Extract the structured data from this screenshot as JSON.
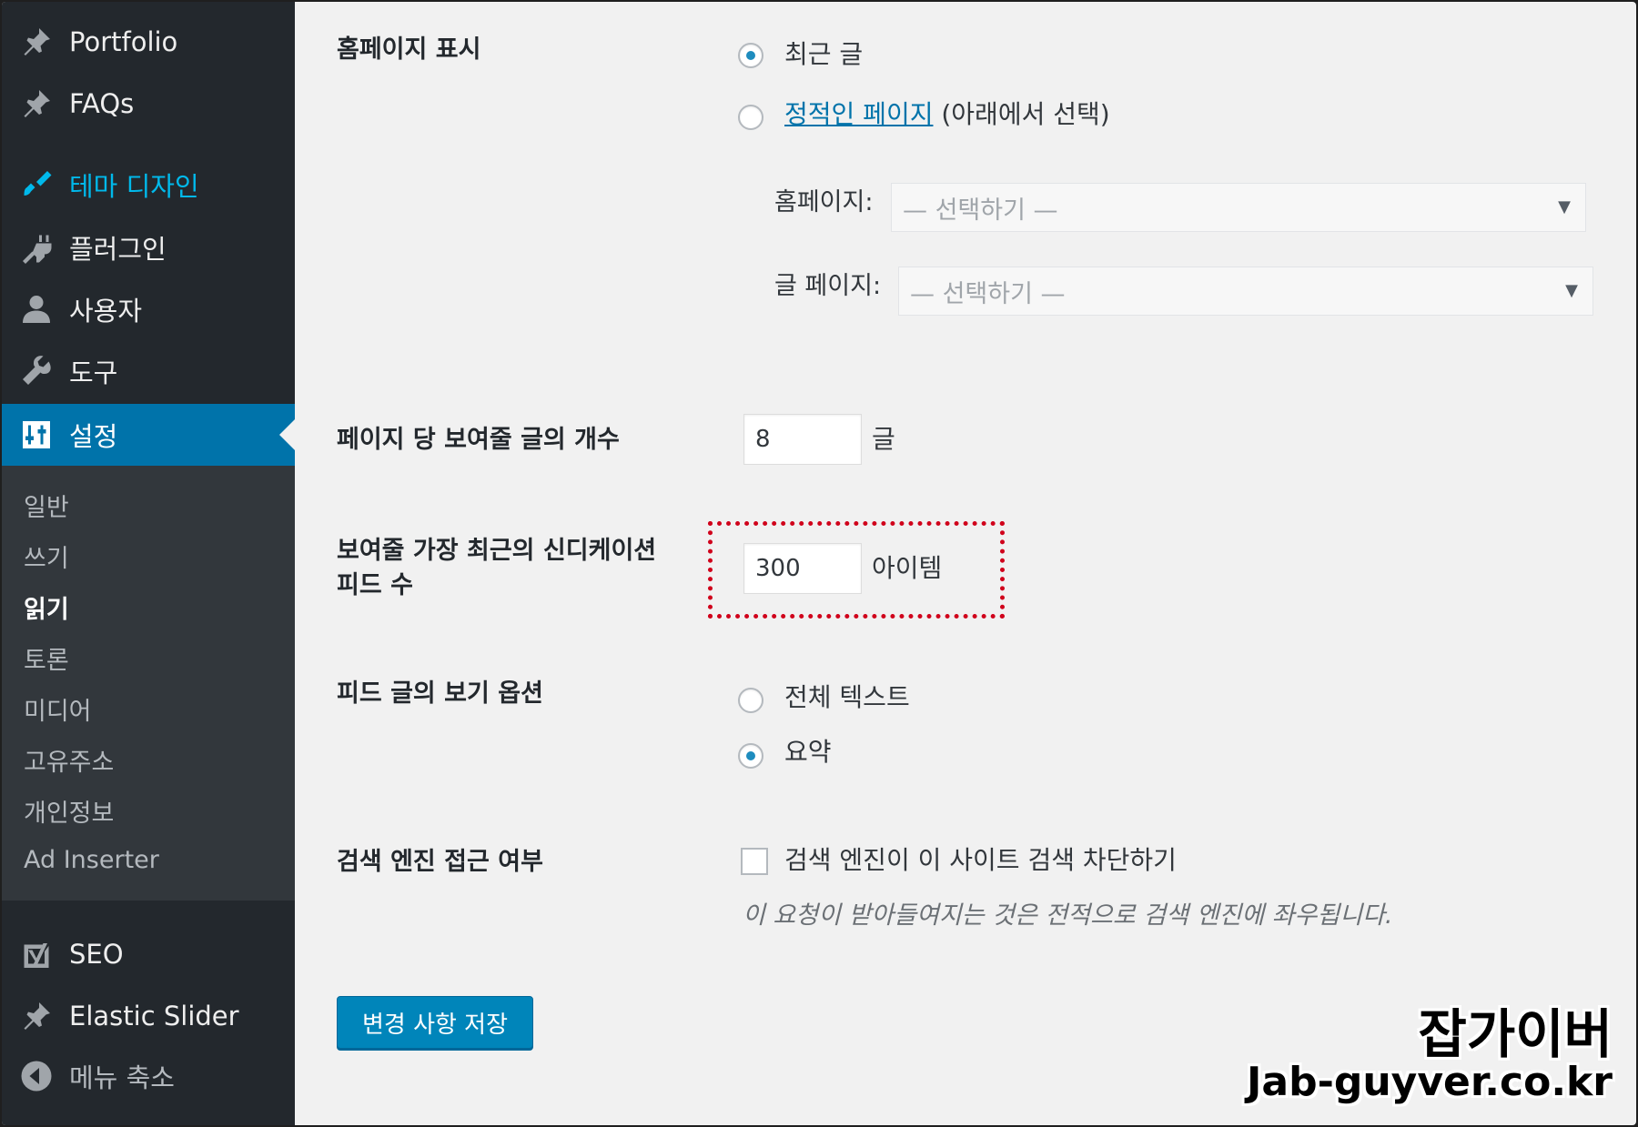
{
  "sidebar": {
    "items": [
      {
        "label": "Portfolio",
        "icon": "pin-icon"
      },
      {
        "label": "FAQs",
        "icon": "pin-icon"
      },
      {
        "label": "테마 디자인",
        "icon": "paintbrush-icon"
      },
      {
        "label": "플러그인",
        "icon": "plugin-icon"
      },
      {
        "label": "사용자",
        "icon": "user-icon"
      },
      {
        "label": "도구",
        "icon": "wrench-icon"
      },
      {
        "label": "설정",
        "icon": "settings-sliders-icon"
      }
    ],
    "submenu": [
      "일반",
      "쓰기",
      "읽기",
      "토론",
      "미디어",
      "고유주소",
      "개인정보",
      "Ad Inserter"
    ],
    "current_submenu": "읽기",
    "bottom_items": [
      {
        "label": "SEO",
        "icon": "yoast-icon"
      },
      {
        "label": "Elastic Slider",
        "icon": "pin-icon"
      },
      {
        "label": "메뉴 축소",
        "icon": "collapse-icon"
      }
    ]
  },
  "reading": {
    "homepage_display": {
      "label": "홈페이지 표시",
      "option_latest": "최근 글",
      "option_static_link": "정적인 페이지",
      "option_static_suffix": "(아래에서 선택)",
      "homepage_label": "홈페이지:",
      "homepage_select": "— 선택하기 —",
      "posts_page_label": "글 페이지:",
      "posts_page_select": "— 선택하기 —",
      "selected": "최근 글"
    },
    "posts_per_page": {
      "label": "페이지 당 보여줄 글의 개수",
      "value": "8",
      "unit": "글"
    },
    "syndication_feeds": {
      "label_line1": "보여줄 가장 최근의 신디케이션",
      "label_line2": "피드 수",
      "value": "300",
      "unit": "아이템"
    },
    "feed_content": {
      "label": "피드 글의 보기 옵션",
      "option_full": "전체 텍스트",
      "option_summary": "요약",
      "selected": "요약"
    },
    "search_visibility": {
      "label": "검색 엔진 접근 여부",
      "checkbox_label": "검색 엔진이 이 사이트 검색 차단하기",
      "checked": false,
      "description": "이 요청이 받아들여지는 것은 전적으로 검색 엔진에 좌우됩니다."
    },
    "save_button": "변경 사항 저장"
  },
  "watermark": {
    "line1": "잡가이버",
    "line2": "Jab-guyver.co.kr"
  },
  "colors": {
    "sidebar_bg": "#23282d",
    "submenu_bg": "#32373c",
    "accent": "#0073aa",
    "highlight": "#d0021b",
    "button": "#0085ba"
  }
}
